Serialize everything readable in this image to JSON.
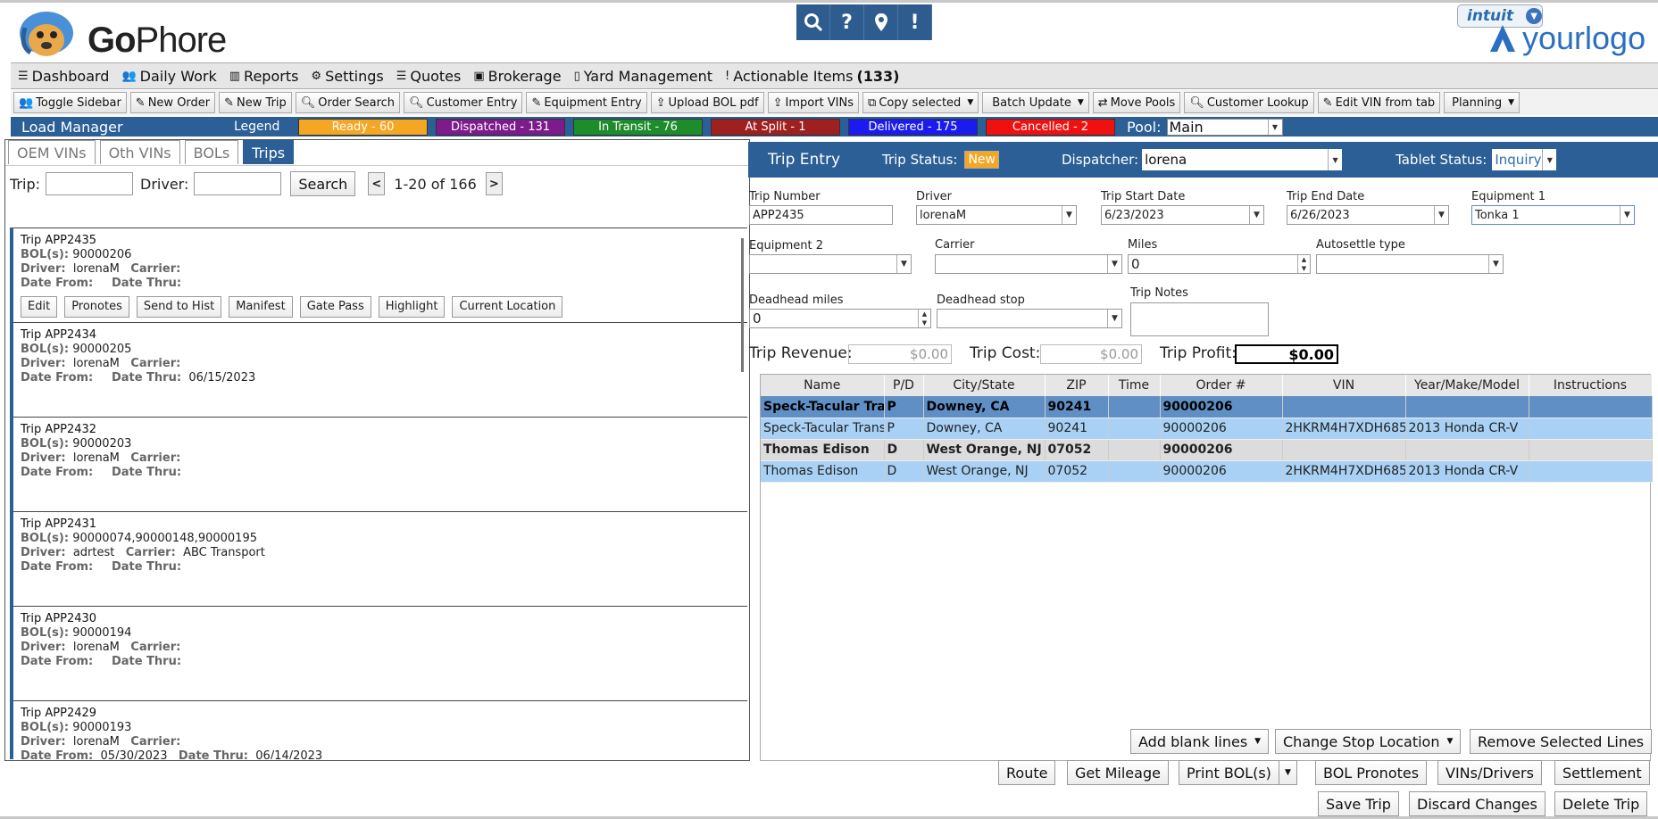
{
  "brand": {
    "name_bold": "Go",
    "name_rest": "Phore",
    "right_logo": "yourlogo",
    "intuit": "intuit"
  },
  "top_icons": [
    "search-icon",
    "help-icon",
    "location-pin-icon",
    "alert-icon"
  ],
  "nav": [
    {
      "icon": "dashboard-icon",
      "label": "Dashboard"
    },
    {
      "icon": "users-icon",
      "label": "Daily Work"
    },
    {
      "icon": "chart-icon",
      "label": "Reports"
    },
    {
      "icon": "gear-icon",
      "label": "Settings"
    },
    {
      "icon": "list-icon",
      "label": "Quotes"
    },
    {
      "icon": "money-icon",
      "label": "Brokerage"
    },
    {
      "icon": "building-icon",
      "label": "Yard Management"
    },
    {
      "icon": "exclamation-icon",
      "label": "Actionable Items",
      "count": "(133)"
    }
  ],
  "toolbar": [
    {
      "icon": "users-icon",
      "label": "Toggle Sidebar"
    },
    {
      "icon": "edit-icon",
      "label": "New Order"
    },
    {
      "icon": "edit-icon",
      "label": "New Trip"
    },
    {
      "icon": "search-icon",
      "label": "Order Search"
    },
    {
      "icon": "search-icon",
      "label": "Customer Entry"
    },
    {
      "icon": "edit-icon",
      "label": "Equipment Entry"
    },
    {
      "icon": "upload-icon",
      "label": "Upload BOL pdf"
    },
    {
      "icon": "upload-icon",
      "label": "Import VINs"
    },
    {
      "icon": "copy-icon",
      "label": "Copy selected",
      "dropdown": true
    },
    {
      "icon": "",
      "label": "Batch Update",
      "dropdown": true
    },
    {
      "icon": "move-icon",
      "label": "Move Pools"
    },
    {
      "icon": "search-icon",
      "label": "Customer Lookup"
    },
    {
      "icon": "edit-icon",
      "label": "Edit VIN from tab"
    },
    {
      "icon": "",
      "label": "Planning",
      "dropdown": true
    }
  ],
  "legend": {
    "title": "Load Manager",
    "label": "Legend",
    "items": [
      {
        "label": "Ready - 60",
        "bg": "#f5a623",
        "fg": "#ffffff",
        "w": 145
      },
      {
        "label": "Dispatched - 131",
        "bg": "#7d1a8c",
        "fg": "#ffffff",
        "w": 145
      },
      {
        "label": "In Transit - 76",
        "bg": "#1e8c2a",
        "fg": "#ffffff",
        "w": 145
      },
      {
        "label": "At Split - 1",
        "bg": "#a02020",
        "fg": "#ffffff",
        "w": 145
      },
      {
        "label": "Delivered - 175",
        "bg": "#1b1bf0",
        "fg": "#ffffff",
        "w": 145
      },
      {
        "label": "Cancelled - 2",
        "bg": "#f01010",
        "fg": "#ffffff",
        "w": 145
      }
    ],
    "pool_label": "Pool:",
    "pool_value": "Main"
  },
  "left": {
    "tabs": [
      "OEM VINs",
      "Oth VINs",
      "BOLs",
      "Trips"
    ],
    "trip_label": "Trip:",
    "driver_label": "Driver:",
    "search_label": "Search",
    "paging": "1-20 of 166",
    "field_labels": {
      "bol": "BOL(s):",
      "driver": "Driver:",
      "carrier": "Carrier:",
      "date_from": "Date From:",
      "date_thru": "Date Thru:"
    },
    "actions": [
      "Edit",
      "Pronotes",
      "Send to Hist",
      "Manifest",
      "Gate Pass",
      "Highlight",
      "Current Location"
    ],
    "trips": [
      {
        "title": "Trip APP2435",
        "bol": "90000206",
        "driver": "lorenaM",
        "carrier": "",
        "from": "",
        "thru": "",
        "selected": true
      },
      {
        "title": "Trip APP2434",
        "bol": "90000205",
        "driver": "lorenaM",
        "carrier": "",
        "from": "",
        "thru": "06/15/2023"
      },
      {
        "title": "Trip APP2432",
        "bol": "90000203",
        "driver": "lorenaM",
        "carrier": "",
        "from": "",
        "thru": ""
      },
      {
        "title": "Trip APP2431",
        "bol": "90000074,90000148,90000195",
        "driver": "adrtest",
        "carrier": "ABC Transport",
        "from": "",
        "thru": ""
      },
      {
        "title": "Trip APP2430",
        "bol": "90000194",
        "driver": "lorenaM",
        "carrier": "",
        "from": "",
        "thru": ""
      },
      {
        "title": "Trip APP2429",
        "bol": "90000193",
        "driver": "lorenaM",
        "carrier": "",
        "from": "05/30/2023",
        "thru": "06/14/2023"
      }
    ]
  },
  "trip_entry": {
    "title": "Trip Entry",
    "status_label": "Trip Status:",
    "status_value": "New",
    "dispatcher_label": "Dispatcher:",
    "dispatcher_value": "lorena",
    "tablet_label": "Tablet Status:",
    "tablet_value": "Inquiry",
    "fields": {
      "trip_number": {
        "label": "Trip Number",
        "value": "APP2435"
      },
      "driver": {
        "label": "Driver",
        "value": "lorenaM"
      },
      "start": {
        "label": "Trip Start Date",
        "value": "6/23/2023"
      },
      "end": {
        "label": "Trip End Date",
        "value": "6/26/2023"
      },
      "equip1": {
        "label": "Equipment 1",
        "value": "Tonka 1"
      },
      "equip2": {
        "label": "Equipment 2",
        "value": ""
      },
      "carrier": {
        "label": "Carrier",
        "value": ""
      },
      "miles": {
        "label": "Miles",
        "value": "0"
      },
      "autosettle": {
        "label": "Autosettle type",
        "value": ""
      },
      "deadhead_miles": {
        "label": "Deadhead miles",
        "value": "0"
      },
      "deadhead_stop": {
        "label": "Deadhead stop",
        "value": ""
      },
      "notes": {
        "label": "Trip Notes",
        "value": ""
      }
    },
    "revenue_label": "Trip Revenue:",
    "revenue": "$0.00",
    "cost_label": "Trip Cost:",
    "cost": "$0.00",
    "profit_label": "Trip Profit:",
    "profit": "$0.00"
  },
  "stops": {
    "columns": [
      "Name",
      "P/D",
      "City/State",
      "ZIP",
      "Time",
      "Order #",
      "VIN",
      "Year/Make/Model",
      "Instructions"
    ],
    "rows": [
      [
        "Speck-Tacular Transport",
        "P",
        "Downey, CA",
        "90241",
        "",
        "90000206",
        "",
        "",
        ""
      ],
      [
        "Speck-Tacular Transport",
        "P",
        "Downey, CA",
        "90241",
        "",
        "90000206",
        "2HKRM4H7XDH685",
        "2013 Honda CR-V",
        ""
      ],
      [
        "Thomas Edison",
        "D",
        "West Orange, NJ",
        "07052",
        "",
        "90000206",
        "",
        "",
        ""
      ],
      [
        "Thomas Edison",
        "D",
        "West Orange, NJ",
        "07052",
        "",
        "90000206",
        "2HKRM4H7XDH685",
        "2013 Honda CR-V",
        ""
      ]
    ]
  },
  "buttons": {
    "add_blank": "Add blank lines",
    "change_stop": "Change Stop Location",
    "remove_lines": "Remove Selected Lines",
    "route": "Route",
    "mileage": "Get Mileage",
    "print_bol": "Print BOL(s)",
    "bol_pronotes": "BOL Pronotes",
    "vins_drivers": "VINs/Drivers",
    "settlement": "Settlement",
    "save": "Save Trip",
    "discard": "Discard Changes",
    "delete": "Delete Trip"
  }
}
